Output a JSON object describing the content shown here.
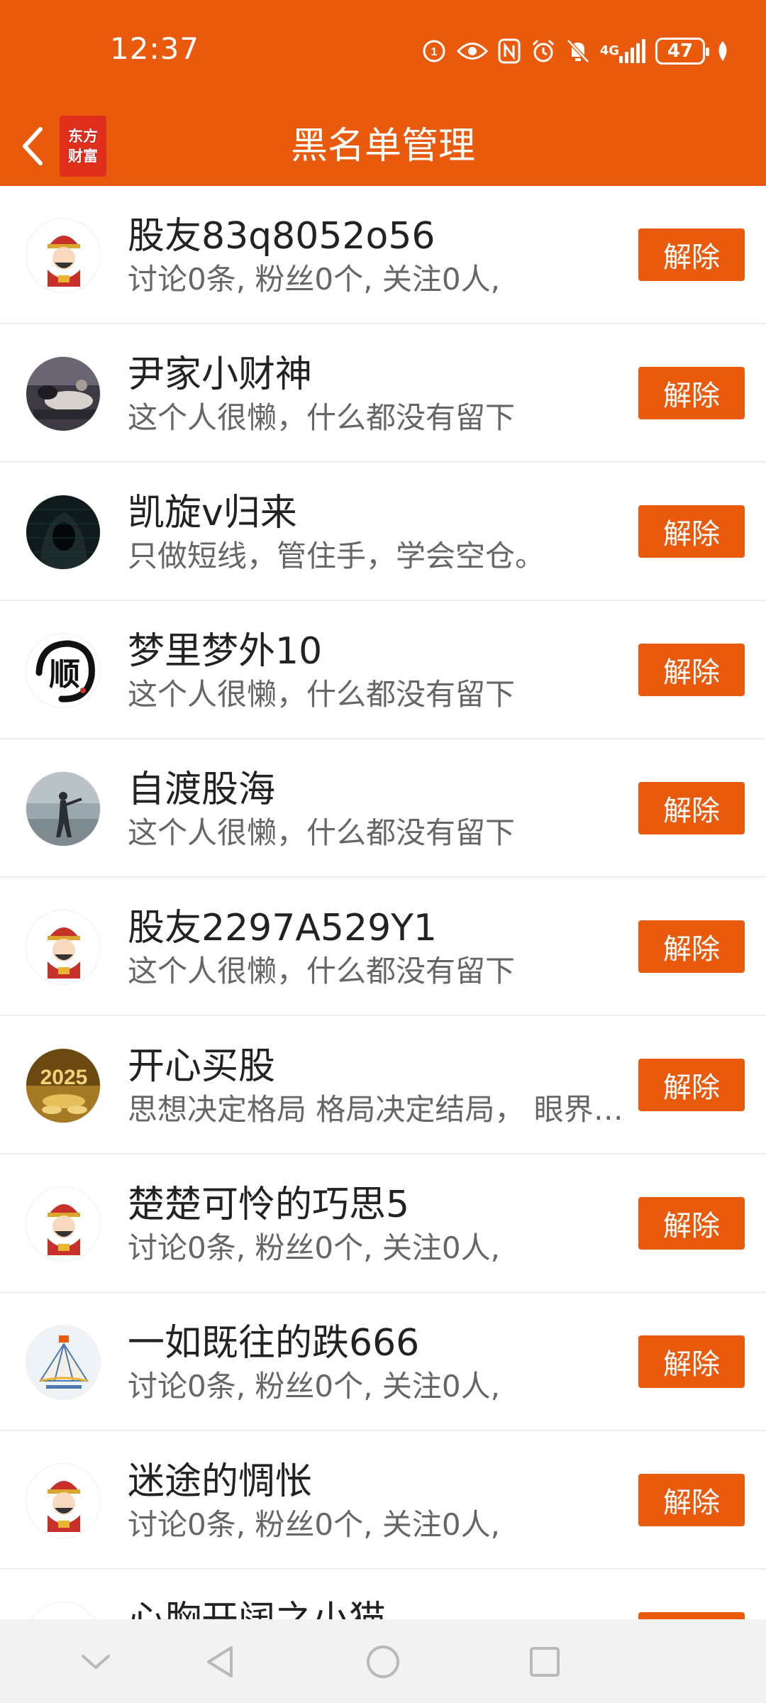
{
  "status_bar": {
    "time": "12:37",
    "network": "4G",
    "battery": "47",
    "icons": [
      "app-notification-icon",
      "eye-icon",
      "nfc-icon",
      "alarm-icon",
      "mute-bell-icon",
      "signal-icon",
      "battery-icon",
      "leaf-icon"
    ]
  },
  "nav": {
    "title": "黑名单管理",
    "back_icon": "chevron-left-icon",
    "logo_line1": "东方",
    "logo_line2": "财富"
  },
  "colors": {
    "accent": "#e95a0c",
    "logo_red": "#e0301c",
    "text_primary": "#222222",
    "text_secondary": "#666666"
  },
  "users": [
    {
      "name": "股友83q8052o56",
      "desc": "讨论0条, 粉丝0个, 关注0人,",
      "avatar": "fortune-god-avatar",
      "button": "解除"
    },
    {
      "name": "尹家小财神",
      "desc": "这个人很懒，什么都没有留下",
      "avatar": "photo-avatar",
      "button": "解除"
    },
    {
      "name": "凯旋v归来",
      "desc": "只做短线，管住手，学会空仓。",
      "avatar": "hooded-figure-avatar",
      "button": "解除"
    },
    {
      "name": "梦里梦外10",
      "desc": "这个人很懒，什么都没有留下",
      "avatar": "calligraphy-avatar",
      "button": "解除"
    },
    {
      "name": "自渡股海",
      "desc": "这个人很懒，什么都没有留下",
      "avatar": "beach-photo-avatar",
      "button": "解除"
    },
    {
      "name": "股友2297A529Y1",
      "desc": "这个人很懒，什么都没有留下",
      "avatar": "fortune-god-avatar",
      "button": "解除"
    },
    {
      "name": "开心买股",
      "desc": "思想决定格局 格局决定结局，  眼界决定境界",
      "avatar": "gold-2025-avatar",
      "button": "解除"
    },
    {
      "name": "楚楚可怜的巧思5",
      "desc": "讨论0条, 粉丝0个, 关注0人,",
      "avatar": "fortune-god-avatar",
      "button": "解除"
    },
    {
      "name": "一如既往的跌666",
      "desc": "讨论0条, 粉丝0个, 关注0人,",
      "avatar": "mountain-logo-avatar",
      "button": "解除"
    },
    {
      "name": "迷途的惆怅",
      "desc": "讨论0条, 粉丝0个, 关注0人,",
      "avatar": "fortune-god-avatar",
      "button": "解除"
    },
    {
      "name": "心胸开阔之小猫",
      "desc": "",
      "avatar": "fortune-god-avatar",
      "button": "解除"
    }
  ],
  "system_nav": [
    "collapse-icon",
    "back-triangle-icon",
    "home-circle-icon",
    "recents-square-icon"
  ]
}
